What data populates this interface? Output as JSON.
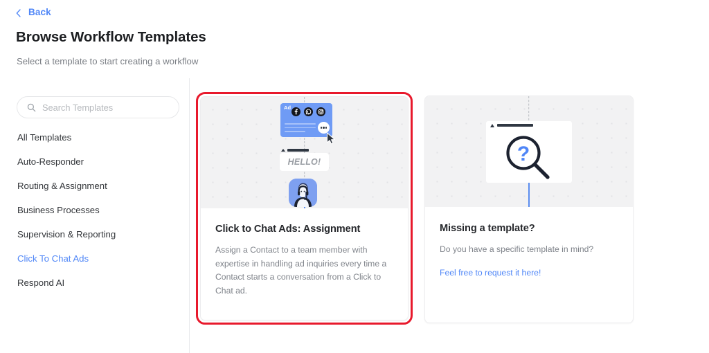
{
  "header": {
    "back_label": "Back",
    "back_icon": "chevron-left-icon",
    "title": "Browse Workflow Templates",
    "subtitle": "Select a template to start creating a workflow"
  },
  "sidebar": {
    "search": {
      "icon": "search-icon",
      "placeholder": "Search Templates",
      "value": ""
    },
    "items": [
      {
        "label": "All Templates",
        "active": false
      },
      {
        "label": "Auto-Responder",
        "active": false
      },
      {
        "label": "Routing & Assignment",
        "active": false
      },
      {
        "label": "Business Processes",
        "active": false
      },
      {
        "label": "Supervision & Reporting",
        "active": false
      },
      {
        "label": "Click To Chat Ads",
        "active": true
      },
      {
        "label": "Respond AI",
        "active": false
      }
    ]
  },
  "cards": {
    "template": {
      "title": "Click to Chat Ads: Assignment",
      "description": "Assign a Contact to a team member with expertise in handling ad inquiries every time a Contact starts a conversation from a Click to Chat ad.",
      "illustration": {
        "ad_label": "Ad",
        "social_icons": [
          "facebook-icon",
          "whatsapp-icon",
          "instagram-icon"
        ],
        "chat_badge_icon": "chat-bubble-icon",
        "cursor_icon": "mouse-cursor-icon",
        "message_text": "HELLO!",
        "agent_icon": "support-agent-avatar-icon"
      },
      "selected": true
    },
    "missing": {
      "title": "Missing a template?",
      "description": "Do you have a specific template in mind?",
      "link": "Feel free to request it here!",
      "illustration": {
        "browser_icon": "browser-window-icon",
        "search_icon": "magnifier-question-icon"
      }
    }
  },
  "colors": {
    "accent": "#4f86f7",
    "highlight": "#e8192c",
    "ad_blue": "#6f9bf5",
    "text_primary": "#26282c",
    "text_muted": "#7f838a"
  }
}
